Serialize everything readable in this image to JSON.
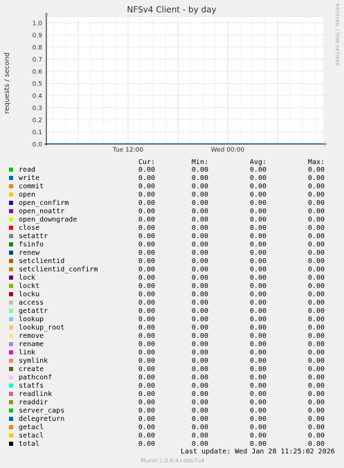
{
  "chart_data": {
    "type": "line",
    "title": "NFSv4 Client - by day",
    "ylabel": "requests / second",
    "watermark": "RRDTOOL / TOBI OETIKER",
    "ylim": [
      0,
      1.0
    ],
    "yticks": [
      "1.0",
      "0.9",
      "0.8",
      "0.7",
      "0.6",
      "0.5",
      "0.4",
      "0.3",
      "0.2",
      "0.1",
      "0.0"
    ],
    "xticks": [
      "Tue 12:00",
      "Wed 00:00"
    ],
    "grid": true,
    "series_all_zero": true
  },
  "legend": {
    "headers": {
      "cur": "Cur:",
      "min": "Min:",
      "avg": "Avg:",
      "max": "Max:"
    },
    "rows": [
      {
        "name": "read",
        "color": "#00cc00",
        "cur": "0.00",
        "min": "0.00",
        "avg": "0.00",
        "max": "0.00"
      },
      {
        "name": "write",
        "color": "#0066b3",
        "cur": "0.00",
        "min": "0.00",
        "avg": "0.00",
        "max": "0.00"
      },
      {
        "name": "commit",
        "color": "#ff8000",
        "cur": "0.00",
        "min": "0.00",
        "avg": "0.00",
        "max": "0.00"
      },
      {
        "name": "open",
        "color": "#ffcc00",
        "cur": "0.00",
        "min": "0.00",
        "avg": "0.00",
        "max": "0.00"
      },
      {
        "name": "open_confirm",
        "color": "#330099",
        "cur": "0.00",
        "min": "0.00",
        "avg": "0.00",
        "max": "0.00"
      },
      {
        "name": "open_noattr",
        "color": "#990099",
        "cur": "0.00",
        "min": "0.00",
        "avg": "0.00",
        "max": "0.00"
      },
      {
        "name": "open_downgrade",
        "color": "#ccff00",
        "cur": "0.00",
        "min": "0.00",
        "avg": "0.00",
        "max": "0.00"
      },
      {
        "name": "close",
        "color": "#ff0000",
        "cur": "0.00",
        "min": "0.00",
        "avg": "0.00",
        "max": "0.00"
      },
      {
        "name": "setattr",
        "color": "#808080",
        "cur": "0.00",
        "min": "0.00",
        "avg": "0.00",
        "max": "0.00"
      },
      {
        "name": "fsinfo",
        "color": "#008f00",
        "cur": "0.00",
        "min": "0.00",
        "avg": "0.00",
        "max": "0.00"
      },
      {
        "name": "renew",
        "color": "#00487d",
        "cur": "0.00",
        "min": "0.00",
        "avg": "0.00",
        "max": "0.00"
      },
      {
        "name": "setclientid",
        "color": "#b35a00",
        "cur": "0.00",
        "min": "0.00",
        "avg": "0.00",
        "max": "0.00"
      },
      {
        "name": "setclientid_confirm",
        "color": "#b38f00",
        "cur": "0.00",
        "min": "0.00",
        "avg": "0.00",
        "max": "0.00"
      },
      {
        "name": "lock",
        "color": "#6b006b",
        "cur": "0.00",
        "min": "0.00",
        "avg": "0.00",
        "max": "0.00"
      },
      {
        "name": "lockt",
        "color": "#8fb300",
        "cur": "0.00",
        "min": "0.00",
        "avg": "0.00",
        "max": "0.00"
      },
      {
        "name": "locku",
        "color": "#b30000",
        "cur": "0.00",
        "min": "0.00",
        "avg": "0.00",
        "max": "0.00"
      },
      {
        "name": "access",
        "color": "#bebebe",
        "cur": "0.00",
        "min": "0.00",
        "avg": "0.00",
        "max": "0.00"
      },
      {
        "name": "getattr",
        "color": "#80ff80",
        "cur": "0.00",
        "min": "0.00",
        "avg": "0.00",
        "max": "0.00"
      },
      {
        "name": "lookup",
        "color": "#80c9ff",
        "cur": "0.00",
        "min": "0.00",
        "avg": "0.00",
        "max": "0.00"
      },
      {
        "name": "lookup_root",
        "color": "#ffc080",
        "cur": "0.00",
        "min": "0.00",
        "avg": "0.00",
        "max": "0.00"
      },
      {
        "name": "remove",
        "color": "#ffe680",
        "cur": "0.00",
        "min": "0.00",
        "avg": "0.00",
        "max": "0.00"
      },
      {
        "name": "rename",
        "color": "#aa80ff",
        "cur": "0.00",
        "min": "0.00",
        "avg": "0.00",
        "max": "0.00"
      },
      {
        "name": "link",
        "color": "#ee00cc",
        "cur": "0.00",
        "min": "0.00",
        "avg": "0.00",
        "max": "0.00"
      },
      {
        "name": "symlink",
        "color": "#ff8080",
        "cur": "0.00",
        "min": "0.00",
        "avg": "0.00",
        "max": "0.00"
      },
      {
        "name": "create",
        "color": "#666600",
        "cur": "0.00",
        "min": "0.00",
        "avg": "0.00",
        "max": "0.00"
      },
      {
        "name": "pathconf",
        "color": "#ffbfff",
        "cur": "0.00",
        "min": "0.00",
        "avg": "0.00",
        "max": "0.00"
      },
      {
        "name": "statfs",
        "color": "#00ffcc",
        "cur": "0.00",
        "min": "0.00",
        "avg": "0.00",
        "max": "0.00"
      },
      {
        "name": "readlink",
        "color": "#cc6699",
        "cur": "0.00",
        "min": "0.00",
        "avg": "0.00",
        "max": "0.00"
      },
      {
        "name": "readdir",
        "color": "#999900",
        "cur": "0.00",
        "min": "0.00",
        "avg": "0.00",
        "max": "0.00"
      },
      {
        "name": "server_caps",
        "color": "#00cc00",
        "cur": "0.00",
        "min": "0.00",
        "avg": "0.00",
        "max": "0.00"
      },
      {
        "name": "delegreturn",
        "color": "#0066b3",
        "cur": "0.00",
        "min": "0.00",
        "avg": "0.00",
        "max": "0.00"
      },
      {
        "name": "getacl",
        "color": "#ff8000",
        "cur": "0.00",
        "min": "0.00",
        "avg": "0.00",
        "max": "0.00"
      },
      {
        "name": "setacl",
        "color": "#ffcc00",
        "cur": "0.00",
        "min": "0.00",
        "avg": "0.00",
        "max": "0.00"
      },
      {
        "name": "total",
        "color": "#000000",
        "cur": "0.00",
        "min": "0.00",
        "avg": "0.00",
        "max": "0.00"
      }
    ]
  },
  "footer": {
    "last_update": "Last update:  Wed Jan 28 11:25:02 2026",
    "version": "Munin 2.0.6-4+deb7u4"
  }
}
